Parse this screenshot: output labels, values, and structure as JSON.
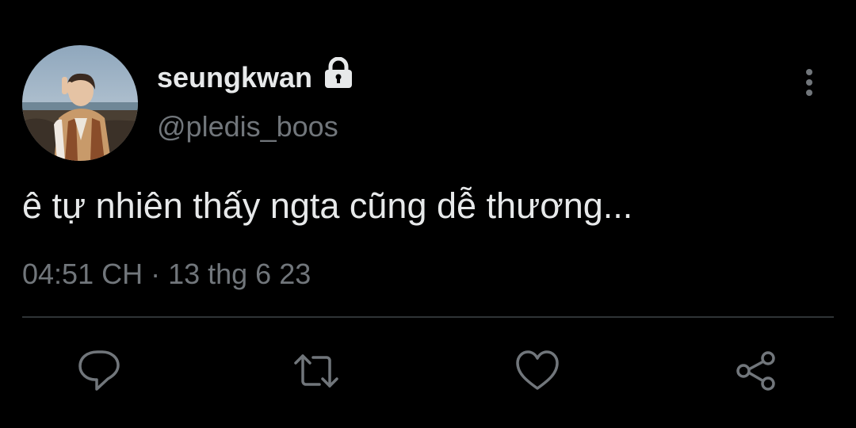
{
  "colors": {
    "background": "#000000",
    "primary_text": "#e7e9ea",
    "secondary_text": "#71767b",
    "divider": "#2f3336"
  },
  "tweet": {
    "author": {
      "display_name": "seungkwan",
      "handle": "@pledis_boos",
      "protected_icon": "lock-icon",
      "avatar": "avatar"
    },
    "text": "ê tự nhiên thấy ngta cũng dễ thương...",
    "timestamp": "04:51 CH · 13 thg 6 23"
  },
  "menu": {
    "icon": "more-vertical-icon"
  },
  "actions": [
    {
      "name": "reply",
      "icon": "comment-icon"
    },
    {
      "name": "retweet",
      "icon": "retweet-icon"
    },
    {
      "name": "like",
      "icon": "heart-icon"
    },
    {
      "name": "share",
      "icon": "share-icon"
    }
  ]
}
